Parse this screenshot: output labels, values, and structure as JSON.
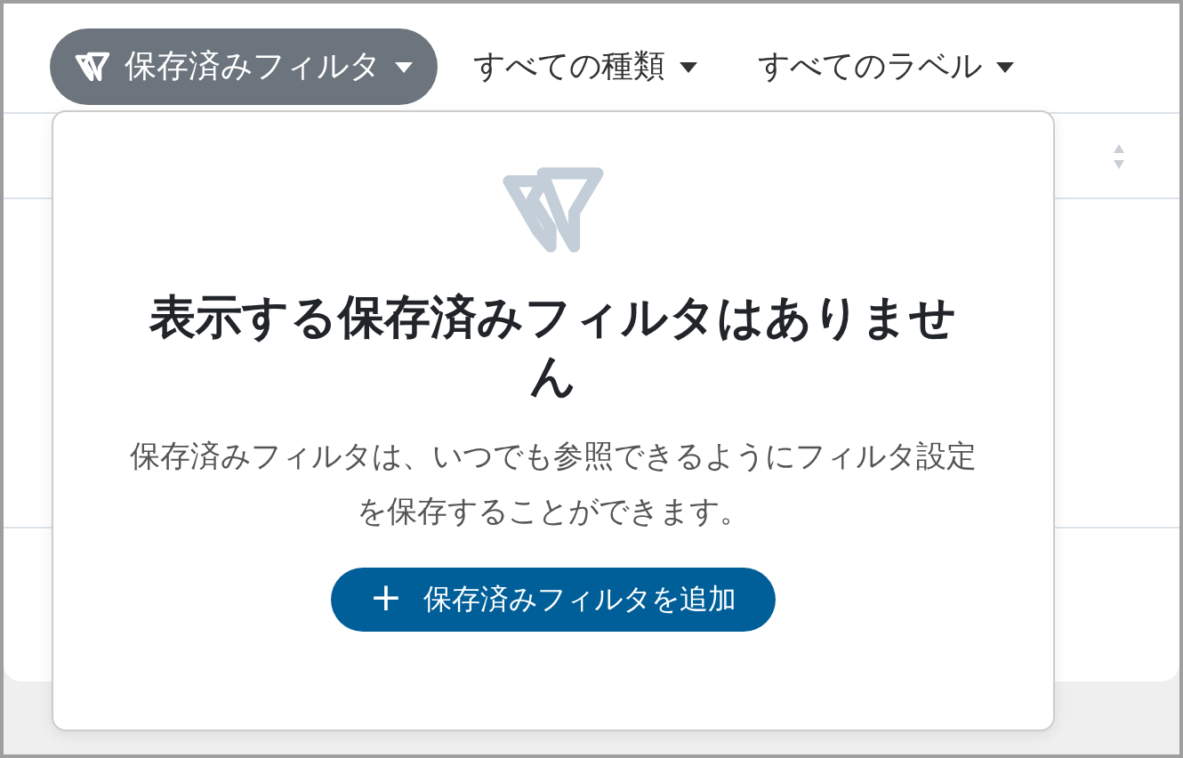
{
  "filters": [
    {
      "label": "保存済みフィルタ",
      "selected": true,
      "kind": "saved"
    },
    {
      "label": "すべての種類",
      "selected": false,
      "kind": "plain"
    },
    {
      "label": "すべてのラベル",
      "selected": false,
      "kind": "plain"
    }
  ],
  "dropdown": {
    "title": "表示する保存済みフィルタはありません",
    "description": "保存済みフィルタは、いつでも参照できるようにフィルタ設定を保存することができます。",
    "add_button": {
      "icon": "+",
      "label": "保存済みフィルタを追加"
    }
  }
}
